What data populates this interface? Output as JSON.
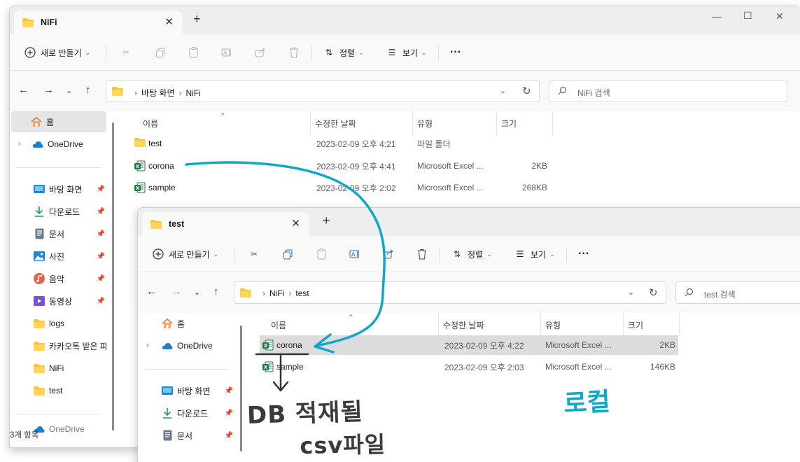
{
  "window_back": {
    "tab_title": "NiFi",
    "toolbar": {
      "new_label": "새로 만들기",
      "sort_label": "정렬",
      "view_label": "보기",
      "more_label": "···"
    },
    "breadcrumb": [
      "바탕 화면",
      "NiFi"
    ],
    "search_placeholder": "NiFi 검색",
    "sidebar": {
      "home": "홈",
      "onedrive": "OneDrive",
      "quick": [
        "바탕 화면",
        "다운로드",
        "문서",
        "사진",
        "음악",
        "동영상"
      ],
      "folders": [
        "logs",
        "카카오톡 받은 파일",
        "NiFi",
        "test"
      ],
      "partial": "OneDrive"
    },
    "columns": {
      "name": "이름",
      "modified": "수정한 날짜",
      "type": "유형",
      "size": "크기"
    },
    "files": [
      {
        "name": "test",
        "modified": "2023-02-09 오후 4:21",
        "type": "파일 폴더",
        "size": "",
        "icon": "folder-icon"
      },
      {
        "name": "corona",
        "modified": "2023-02-09 오후 4:41",
        "type": "Microsoft Excel ...",
        "size": "2KB",
        "icon": "excel-csv-icon"
      },
      {
        "name": "sample",
        "modified": "2023-02-09 오후 2:02",
        "type": "Microsoft Excel ...",
        "size": "268KB",
        "icon": "excel-csv-icon"
      }
    ],
    "status": "3개 항목"
  },
  "window_front": {
    "tab_title": "test",
    "toolbar": {
      "new_label": "새로 만들기",
      "sort_label": "정렬",
      "view_label": "보기",
      "more_label": "···"
    },
    "breadcrumb": [
      "NiFi",
      "test"
    ],
    "search_placeholder": "test 검색",
    "sidebar": {
      "home": "홈",
      "onedrive": "OneDrive",
      "quick": [
        "바탕 화면",
        "다운로드",
        "문서"
      ]
    },
    "columns": {
      "name": "이름",
      "modified": "수정한 날짜",
      "type": "유형",
      "size": "크기"
    },
    "files": [
      {
        "name": "corona",
        "modified": "2023-02-09 오후 4:22",
        "type": "Microsoft Excel ...",
        "size": "2KB",
        "icon": "excel-csv-icon",
        "selected": true
      },
      {
        "name": "sample",
        "modified": "2023-02-09 오후 2:03",
        "type": "Microsoft Excel ...",
        "size": "146KB",
        "icon": "excel-csv-icon",
        "selected": false
      }
    ]
  },
  "annotations": {
    "db_note": "DB 적재될",
    "csv_note": "csv파일",
    "local_note": "로컬"
  },
  "colors": {
    "annotation_arrow": "#14a6c9",
    "folder_yellow": "#f6c33f",
    "excel_green": "#1d7a45",
    "selection_gray": "#dcdcdc"
  }
}
